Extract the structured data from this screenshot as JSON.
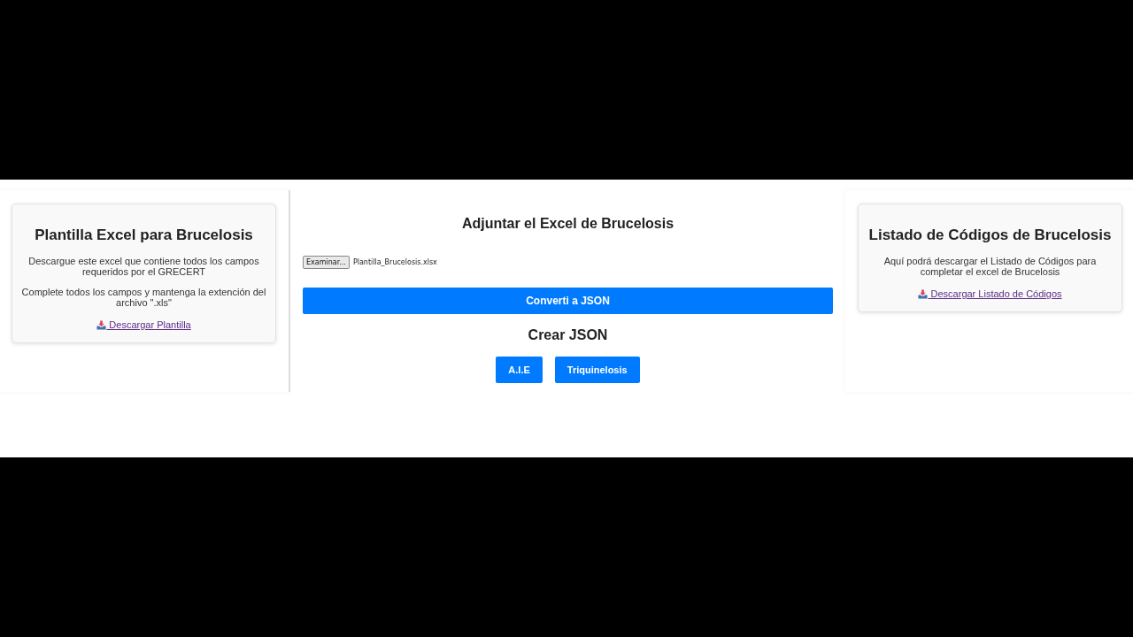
{
  "left_panel": {
    "title": "Plantilla Excel para Brucelosis",
    "paragraphs": [
      "Descargue este excel que contiene todos los campos requeridos por el GRECERT",
      "Complete todos los campos y mantenga la extención del archivo \".xls\""
    ],
    "link": {
      "label": "Descargar Plantilla"
    }
  },
  "main": {
    "title": "Adjuntar el Excel de Brucelosis",
    "file_input": {
      "button": "Examinar...",
      "value": "Plantilla_Brucelosis.xlsx"
    },
    "convert_button": "Converti a JSON",
    "section_title": "Crear JSON",
    "buttons": [
      "A.I.E",
      "Triquinelosis"
    ]
  },
  "right_panel": {
    "title": "Listado de Códigos de Brucelosis",
    "paragraphs": [
      "Aquí podrá descargar el Listado de Códigos para completar el excel de Brucelosis"
    ],
    "link": {
      "label": "Descargar Listado de Códigos"
    }
  }
}
